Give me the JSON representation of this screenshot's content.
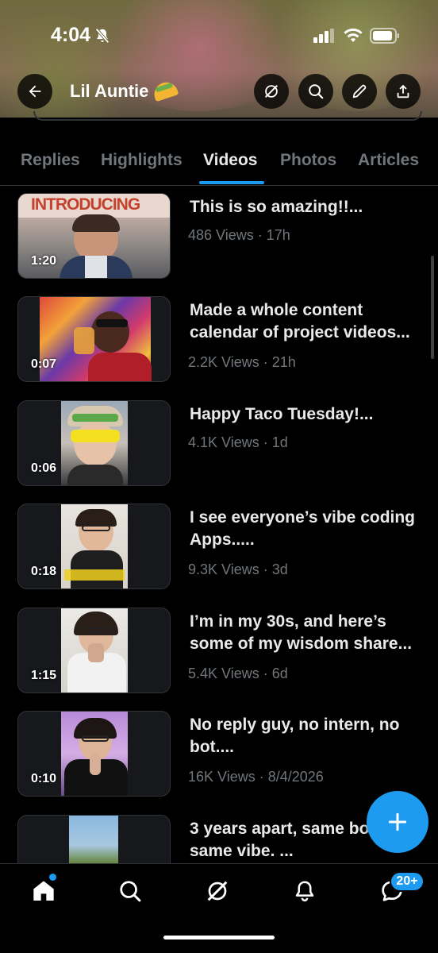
{
  "status_bar": {
    "time": "4:04"
  },
  "header": {
    "profile_name": "Lil Auntie"
  },
  "tabs": [
    {
      "label": "Replies",
      "active": false
    },
    {
      "label": "Highlights",
      "active": false
    },
    {
      "label": "Videos",
      "active": true
    },
    {
      "label": "Photos",
      "active": false
    },
    {
      "label": "Articles",
      "active": false
    }
  ],
  "videos": [
    {
      "duration": "1:20",
      "title_lines": [
        "This is so amazing!!..."
      ],
      "meta": "486 Views · 17h",
      "overlay_text": "INTRODUCING"
    },
    {
      "duration": "0:07",
      "title_lines": [
        "Made a whole content",
        "calendar of project videos..."
      ],
      "meta": "2.2K Views · 21h"
    },
    {
      "duration": "0:06",
      "title_lines": [
        "Happy Taco Tuesday!..."
      ],
      "meta": "4.1K Views · 1d"
    },
    {
      "duration": "0:18",
      "title_lines": [
        "I see everyone’s vibe coding",
        "Apps....."
      ],
      "meta": "9.3K Views · 3d"
    },
    {
      "duration": "1:15",
      "title_lines": [
        "I’m in my 30s, and here’s",
        "some of my wisdom share..."
      ],
      "meta": "5.4K Views · 6d"
    },
    {
      "duration": "0:10",
      "title_lines": [
        "No reply guy, no intern, no",
        "bot...."
      ],
      "meta": "16K Views · 8/4/2026"
    },
    {
      "duration": "",
      "title_lines": [
        "3 years apart, same bo",
        "same vibe. ..."
      ],
      "meta": ""
    }
  ],
  "bottom_nav": {
    "messages_badge": "20+"
  },
  "colors": {
    "accent": "#1d9bf0",
    "background": "#000000",
    "muted_text": "#71767b",
    "primary_text": "#e7e9ea"
  }
}
